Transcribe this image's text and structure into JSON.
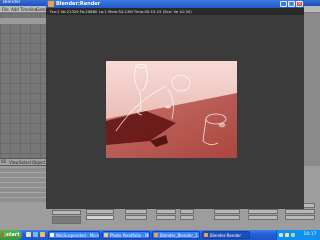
{
  "background_app": {
    "title": "Blender",
    "menus": [
      "File",
      "Add",
      "Timeline",
      "Game"
    ],
    "lower_menus": [
      "View",
      "Select",
      "Object"
    ],
    "lower_label": "60"
  },
  "render_window": {
    "title": "Blender:Render",
    "status": "Fra:1  Ve:21329 Fa:20880 La:1 Mem:54.13M  Time:00:15.15  (Sce:  Ve 41:30)",
    "buttons": {
      "minimize": "_",
      "maximize": "□",
      "close": "×"
    }
  },
  "bottom_panel": {
    "field_label": "Blender Ren..."
  },
  "taskbar": {
    "start_label": "start",
    "tasks": [
      {
        "label": "NikiSuspended - Microsof...",
        "active": false
      },
      {
        "label": "Photo Pondfolio - Mic...",
        "active": false
      },
      {
        "label": "Blender_Blender_2.4...",
        "active": false
      },
      {
        "label": "Blender:Render",
        "active": true
      }
    ],
    "clock": "10:17"
  },
  "colors": {
    "titlebar_blue": "#2058c8",
    "render_bg": "#3b3b3b",
    "floor_red": "#a9463f",
    "taskbar_blue": "#245edb",
    "start_green": "#3a943a"
  }
}
